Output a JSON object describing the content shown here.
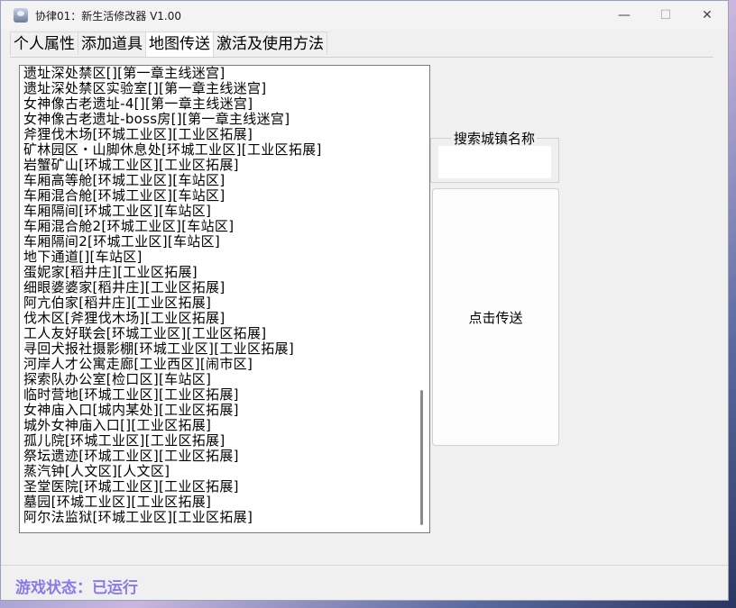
{
  "window": {
    "title": "协律01：新生活修改器 V1.00",
    "minimize": "—",
    "maximize": "☐",
    "close": "✕"
  },
  "tabs": [
    {
      "label": "个人属性",
      "active": false
    },
    {
      "label": "添加道具",
      "active": false
    },
    {
      "label": "地图传送",
      "active": true
    },
    {
      "label": "激活及使用方法",
      "active": false
    }
  ],
  "locations": [
    "遗址深处禁区[][第一章主线迷宫]",
    "遗址深处禁区实验室[][第一章主线迷宫]",
    "女神像古老遗址-4[][第一章主线迷宫]",
    "女神像古老遗址-boss房[][第一章主线迷宫]",
    "斧狸伐木场[环城工业区][工业区拓展]",
    "矿林园区・山脚休息处[环城工业区][工业区拓展]",
    "岩蟹矿山[环城工业区][工业区拓展]",
    "车厢高等舱[环城工业区][车站区]",
    "车厢混合舱[环城工业区][车站区]",
    "车厢隔间[环城工业区][车站区]",
    "车厢混合舱2[环城工业区][车站区]",
    "车厢隔间2[环城工业区][车站区]",
    "地下通道[][车站区]",
    "蛋妮家[稻井庄][工业区拓展]",
    "细眼婆婆家[稻井庄][工业区拓展]",
    "阿亢伯家[稻井庄][工业区拓展]",
    "伐木区[斧狸伐木场][工业区拓展]",
    "工人友好联会[环城工业区][工业区拓展]",
    "寻回犬报社摄影棚[环城工业区][工业区拓展]",
    "河岸人才公寓走廊[工业西区][闹市区]",
    "探索队办公室[检口区][车站区]",
    "临时营地[环城工业区][工业区拓展]",
    "女神庙入口[城内某处][工业区拓展]",
    "城外女神庙入口[][工业区拓展]",
    "孤儿院[环城工业区][工业区拓展]",
    "祭坛遗迹[环城工业区][工业区拓展]",
    "蒸汽钟[人文区][人文区]",
    "圣堂医院[环城工业区][工业区拓展]",
    "墓园[环城工业区][工业区拓展]",
    "阿尔法监狱[环城工业区][工业区拓展]"
  ],
  "search": {
    "label": "搜索城镇名称",
    "value": "",
    "placeholder": ""
  },
  "teleport_button": "点击传送",
  "status": {
    "text": "游戏状态：已运行",
    "color": "#8a7ae8"
  },
  "icons": {
    "app": "app-icon"
  }
}
